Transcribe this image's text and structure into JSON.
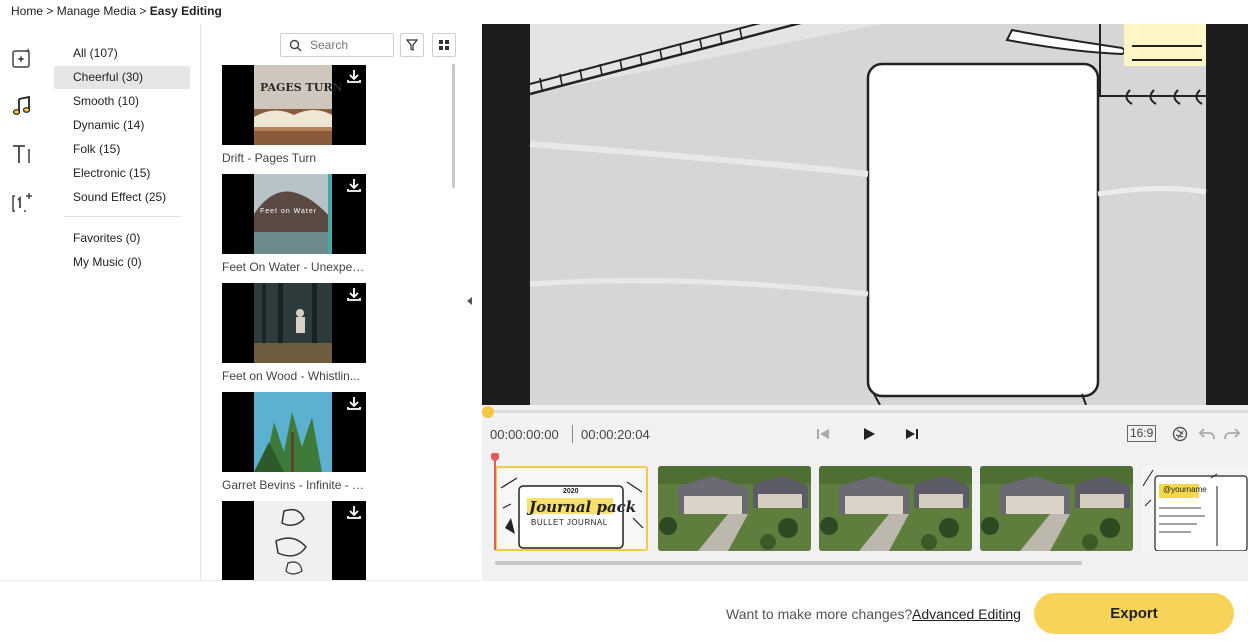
{
  "breadcrumb": {
    "home": "Home",
    "sep1": " > ",
    "manage": "Manage Media",
    "sep2": " > ",
    "current": "Easy Editing"
  },
  "rail": {
    "items": [
      {
        "icon": "ai-sparkle-icon"
      },
      {
        "icon": "music-note-icon",
        "active": true
      },
      {
        "icon": "text-icon"
      },
      {
        "icon": "sticker-add-icon"
      }
    ]
  },
  "categories": {
    "items": [
      {
        "label": "All (107)",
        "active": false
      },
      {
        "label": "Cheerful (30)",
        "active": true
      },
      {
        "label": "Smooth (10)",
        "active": false
      },
      {
        "label": "Dynamic (14)",
        "active": false
      },
      {
        "label": "Folk (15)",
        "active": false
      },
      {
        "label": "Electronic (15)",
        "active": false
      },
      {
        "label": "Sound Effect (25)",
        "active": false
      }
    ],
    "extra": [
      {
        "label": "Favorites (0)"
      },
      {
        "label": "My Music (0)"
      }
    ]
  },
  "media": {
    "search_placeholder": "Search",
    "items": [
      {
        "title": "Drift - Pages Turn",
        "art_text": "PAGES TURN"
      },
      {
        "title": "Feet On Water - Unexpec...",
        "art_text": "Feet on Water"
      },
      {
        "title": "Feet on Wood - Whistlin...",
        "art_text": ""
      },
      {
        "title": "Garret Bevins - Infinite - S...",
        "art_text": ""
      },
      {
        "title": "",
        "art_text": ""
      }
    ]
  },
  "player": {
    "current_time": "00:00:00:00",
    "total_time": "00:00:20:04",
    "aspect_ratio": "16:9",
    "progress": 0
  },
  "timeline": {
    "first_clip_line1": "Journal pack",
    "first_clip_line2": "BULLET JOURNAL",
    "first_clip_year": "2020",
    "last_clip_handle": "@yourname"
  },
  "footer": {
    "question": "Want to make more changes?",
    "link": "Advanced Editing",
    "export": "Export"
  },
  "colors": {
    "accent": "#f7d35a",
    "playhead": "#e65a5a",
    "selected_bg": "#e5e5e5"
  }
}
